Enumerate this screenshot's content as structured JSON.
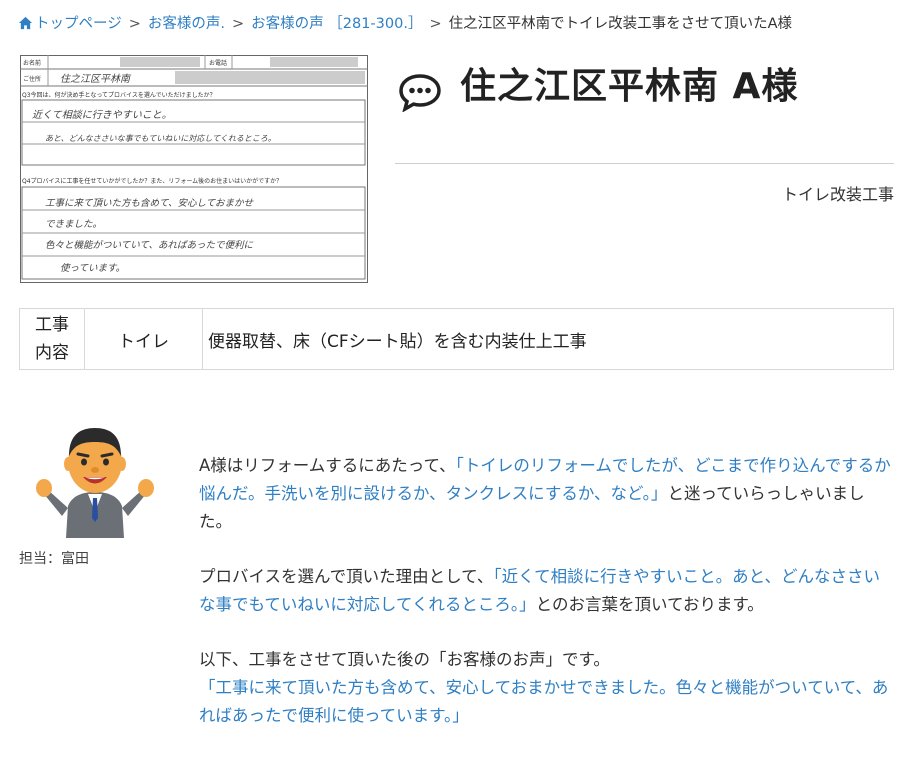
{
  "breadcrumb": {
    "home": "トップページ",
    "voices": "お客様の声.",
    "range": "お客様の声 ［281-300.］",
    "current": "住之江区平林南でトイレ改装工事をさせて頂いたA様"
  },
  "separator": ">",
  "scan": {
    "name_label": "お名前",
    "phone_label": "お電話",
    "address_label": "ご住所",
    "address_value": "住之江区平林南",
    "q3": "Q3今回は、何が決め手となってプロバイスを選んでいただけましたか？",
    "q3_line1": "近くて相談に行きやすいこと。",
    "q3_line2": "あと、どんなささいな事でもていねいに対応してくれるところ。",
    "q4": "Q4プロバイスに工事を任せていかがでしたか？また、リフォーム後のお住まいはいかがですか？",
    "q4_line1": "工事に来て頂いた方も含めて、安心しておまかせ",
    "q4_line2": "できました。",
    "q4_line3": "色々と機能がついていて、あればあったで便利に",
    "q4_line4": "使っています。"
  },
  "title": "住之江区平林南 A様",
  "category": "トイレ改装工事",
  "work": {
    "header": "工事内容",
    "header_line1": "工事",
    "header_line2": "内容",
    "category": "トイレ",
    "description": "便器取替、床（CFシート貼）を含む内装仕上工事"
  },
  "staff": {
    "label": "担当：富田"
  },
  "content": {
    "p1_a": "A様はリフォームするにあたって、",
    "p1_q": "「トイレのリフォームでしたが、どこまで作り込んでするか悩んだ。手洗いを別に設けるか、タンクレスにするか、など。」",
    "p1_b": "と迷っていらっしゃいました。",
    "p2_a": "プロバイスを選んで頂いた理由として、",
    "p2_q": "「近くて相談に行きやすいこと。あと、どんなささいな事でもていねいに対応してくれるところ。」",
    "p2_b": "とのお言葉を頂いております。",
    "p3_a": "以下、工事をさせて頂いた後の「お客様のお声」です。",
    "p3_q": "「工事に来て頂いた方も含めて、安心しておまかせできました。色々と機能がついていて、あればあったで便利に使っています。」"
  },
  "colors": {
    "link": "#2f7fc4",
    "quote": "#2f7fc4",
    "text": "#333333"
  }
}
